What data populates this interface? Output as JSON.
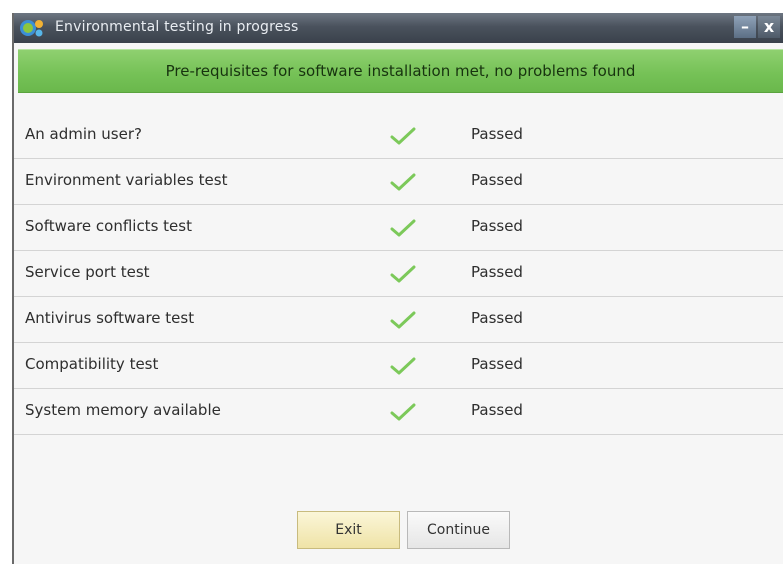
{
  "window": {
    "title": "Environmental testing in progress",
    "minimize_glyph": "–",
    "close_glyph": "x"
  },
  "banner": {
    "message": "Pre-requisites for software installation met, no problems found"
  },
  "tests": [
    {
      "label": "An admin user?",
      "status": "Passed",
      "icon": "checkmark-icon"
    },
    {
      "label": "Environment variables test",
      "status": "Passed",
      "icon": "checkmark-icon"
    },
    {
      "label": "Software conflicts test",
      "status": "Passed",
      "icon": "checkmark-icon"
    },
    {
      "label": "Service port test",
      "status": "Passed",
      "icon": "checkmark-icon"
    },
    {
      "label": "Antivirus software test",
      "status": "Passed",
      "icon": "checkmark-icon"
    },
    {
      "label": "Compatibility test",
      "status": "Passed",
      "icon": "checkmark-icon"
    },
    {
      "label": "System memory available",
      "status": "Passed",
      "icon": "checkmark-icon"
    }
  ],
  "buttons": {
    "exit_label": "Exit",
    "continue_label": "Continue"
  },
  "colors": {
    "banner_green": "#76c257",
    "check_green": "#7cc95a",
    "titlebar": "#4a525d"
  }
}
